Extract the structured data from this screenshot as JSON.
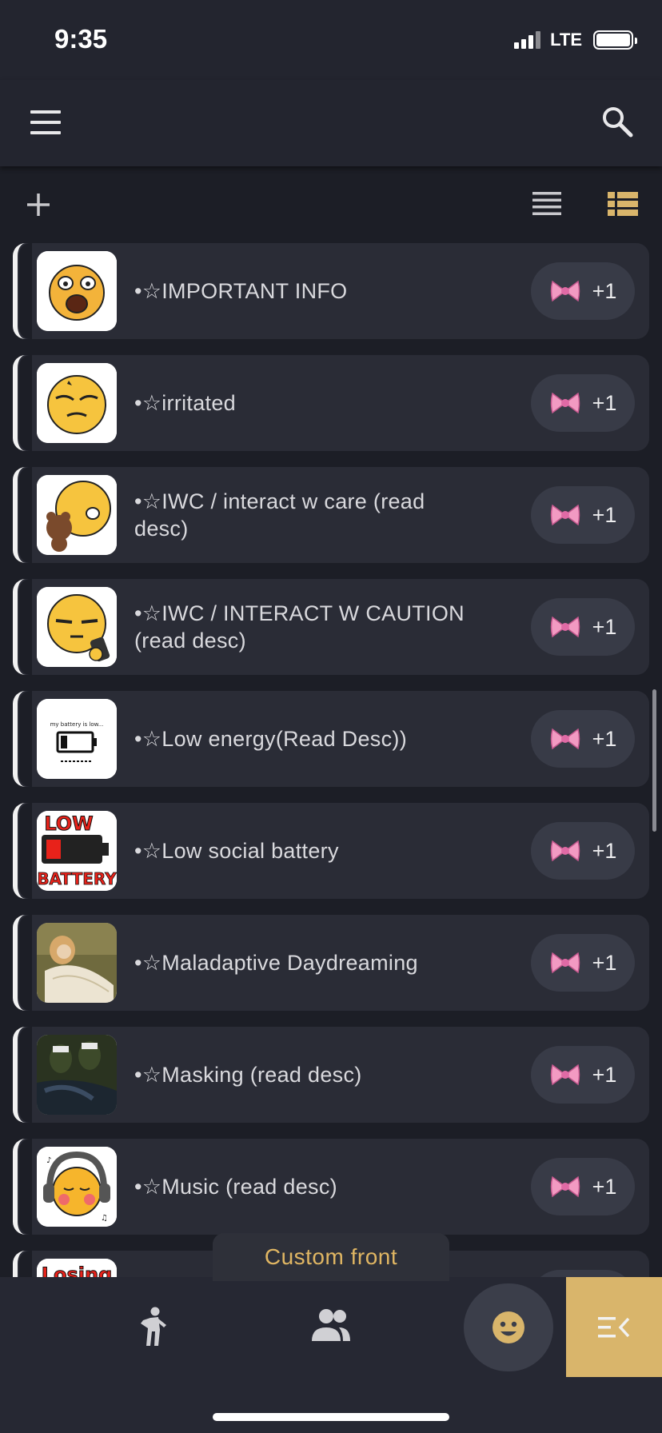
{
  "status_bar": {
    "time": "9:35",
    "network": "LTE"
  },
  "app_bar": {
    "menu_icon": "hamburger-icon",
    "search_icon": "search-icon"
  },
  "toolbar": {
    "add_icon": "plus-icon",
    "view_list_icon": "list-view-icon",
    "view_detail_icon": "detail-list-view-icon",
    "active_color": "#d9b56b"
  },
  "reaction": {
    "emoji_name": "pink-bow-icon",
    "count": "+1"
  },
  "list_items": [
    {
      "label": "•☆IMPORTANT INFO",
      "avatar": "shocked-emoji"
    },
    {
      "label": "•☆irritated",
      "avatar": "irritated-emoji"
    },
    {
      "label": "•☆IWC / interact w care (read desc)",
      "avatar": "emoji-with-teddy-bear"
    },
    {
      "label": "•☆IWC / INTERACT W CAUTION (read desc)",
      "avatar": "emoji-with-phone"
    },
    {
      "label": "•☆Low energy(Read Desc))",
      "avatar": "low-battery-sketch",
      "avatar_text": "my battery is low..."
    },
    {
      "label": "•☆Low social battery",
      "avatar": "low-battery-sticker",
      "avatar_text": [
        "LOW",
        "BATTERY"
      ]
    },
    {
      "label": "•☆Maladaptive Daydreaming",
      "avatar": "classical-painting"
    },
    {
      "label": "•☆Masking (read desc)",
      "avatar": "sneakers-photo"
    },
    {
      "label": "•☆Music (read desc)",
      "avatar": "headphones-emoji"
    },
    {
      "label": "",
      "avatar": "losing-sticker",
      "avatar_text": "Losing"
    }
  ],
  "custom_front_label": "Custom front",
  "bottom_nav": {
    "items": [
      {
        "icon": "person-front-icon"
      },
      {
        "icon": "members-icon"
      },
      {
        "icon": "emoji-face-icon"
      },
      {
        "icon": "menu-collapse-icon"
      }
    ],
    "accent": "#d9b56b"
  }
}
